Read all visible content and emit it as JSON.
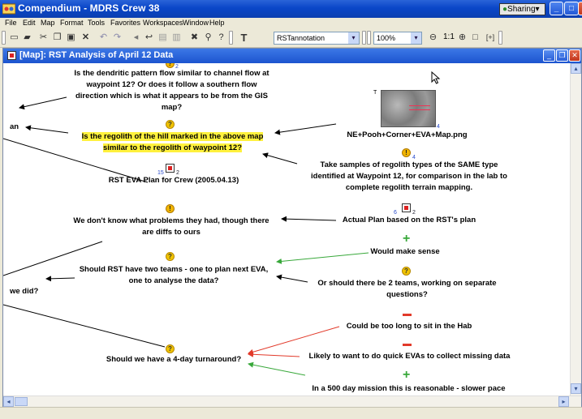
{
  "window": {
    "title": "Compendium - MDRS Crew 38",
    "sharing_label": "Sharing",
    "sharing_arrow": "▾"
  },
  "menubar": [
    "File",
    "Edit",
    "Map",
    "Format",
    "Tools",
    "Favorites",
    "Workspaces",
    "Window",
    "Help"
  ],
  "toolbar": {
    "stencil_select": "RSTannotation",
    "zoom_select": "100%",
    "zoom_label": "1:1",
    "t_label": "T",
    "fit_label": "[+]"
  },
  "map_window": {
    "title": "[Map]: RST Analysis of April 12 Data"
  },
  "colors": {
    "titlebar": "#0a46c8",
    "highlight": "#fff13d",
    "pro_link": "#38a83a",
    "con_link": "#e23a2a"
  },
  "nodes": {
    "top_question": {
      "badge": "2",
      "lines": [
        "Is the dendritic pattern flow similar to channel flow at",
        "waypoint 12? Or does it follow a southern flow",
        "direction which is what it appears to be from the GIS",
        "map?"
      ]
    },
    "left_an": "an",
    "regolith_question": {
      "badge": "",
      "lines": [
        "Is the regolith of the hill marked in the above map",
        "similar to the regolith of waypoint 12?"
      ]
    },
    "eva_plan": {
      "label": "RST EVA Plan for Crew (2005.04.13)",
      "num_left": "15",
      "num_right": "2"
    },
    "problems": {
      "lines": [
        "We don't know what problems they had, though there",
        "are diffs to ours"
      ]
    },
    "two_teams": {
      "lines": [
        "Should RST have two teams - one to plan next EVA,",
        "one to analyse the data?"
      ]
    },
    "we_did": "we did?",
    "four_day": {
      "label": "Should we have a 4-day turnaround?"
    },
    "image_node": {
      "label": "NE+Pooh+Corner+EVA+Map.png",
      "badge": "4",
      "t": "T"
    },
    "samples": {
      "badge": "4",
      "lines": [
        "Take samples of regolith types of the SAME type",
        "identified at Waypoint 12, for comparison in the lab to",
        "complete regolith terrain mapping."
      ]
    },
    "actual_plan": {
      "label": "Actual Plan based on the RST's plan",
      "num_left": "6",
      "num_right": "2"
    },
    "makes_sense": {
      "label": "Would make sense"
    },
    "two_teams_separate": {
      "lines": [
        "Or should there be 2 teams, working on separate",
        "questions?"
      ]
    },
    "too_long": {
      "label": "Could be too long to sit in the Hab"
    },
    "quick_evas": {
      "label": "Likely to want to do quick EVAs to collect missing data"
    },
    "five_hundred": {
      "label": "In a 500 day mission this is reasonable - slower pace"
    }
  }
}
